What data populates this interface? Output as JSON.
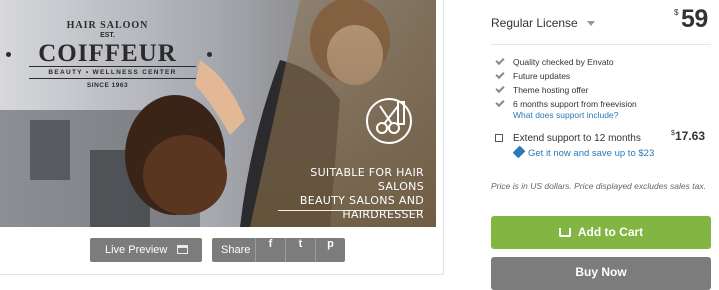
{
  "preview": {
    "brand": {
      "top_text": "HAIR SALOON",
      "est_text": "EST.",
      "name": "COIFFEUR",
      "subtitle": "BEAUTY • WELLNESS CENTER",
      "since": "SINCE 1963"
    },
    "tagline_lines": [
      "SUITABLE FOR HAIR SALONS",
      "BEAUTY SALONS AND",
      "HAIRDRESSER"
    ]
  },
  "actions": {
    "live_preview_label": "Live Preview",
    "share_label": "Share",
    "share_icons": [
      "f",
      "t",
      "p"
    ]
  },
  "license": {
    "title": "Regular License",
    "currency_symbol": "$",
    "price": "59",
    "features": [
      "Quality checked by Envato",
      "Future updates",
      "Theme hosting offer",
      "6 months support from freevision"
    ],
    "support_link": "What does support include?",
    "extend_label": "Extend support to 12 months",
    "extend_currency": "$",
    "extend_price": "17.63",
    "save_text": "Get it now and save up to $23",
    "note": "Price is in US dollars. Price displayed excludes sales tax.",
    "add_to_cart": "Add to Cart",
    "buy_now": "Buy Now"
  },
  "colors": {
    "add_to_cart": "#82b541",
    "buy_now": "#7c7c7c",
    "link": "#2a7ab5"
  }
}
